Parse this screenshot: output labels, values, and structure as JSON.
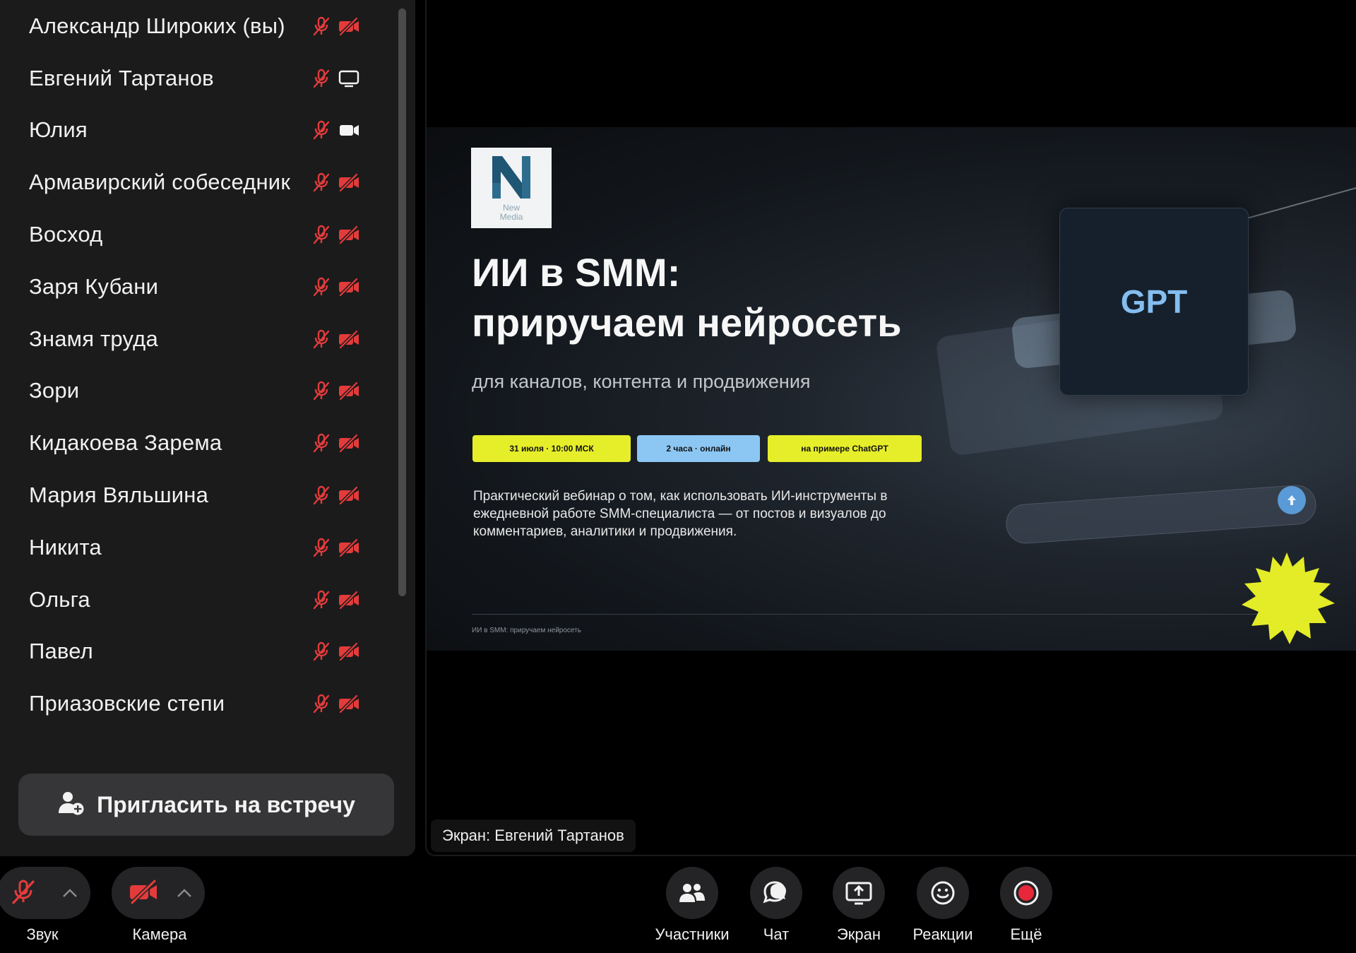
{
  "participants": [
    {
      "name": "Александр Широких (вы)",
      "mic": "muted",
      "video": "off"
    },
    {
      "name": "Евгений Тартанов",
      "mic": "muted",
      "video": "screen"
    },
    {
      "name": "Юлия",
      "mic": "muted",
      "video": "on"
    },
    {
      "name": "Армавирский собеседник",
      "mic": "muted",
      "video": "off"
    },
    {
      "name": "Восход",
      "mic": "muted",
      "video": "off"
    },
    {
      "name": "Заря Кубани",
      "mic": "muted",
      "video": "off"
    },
    {
      "name": "Знамя труда",
      "mic": "muted",
      "video": "off"
    },
    {
      "name": "Зори",
      "mic": "muted",
      "video": "off"
    },
    {
      "name": "Кидакоева Зарема",
      "mic": "muted",
      "video": "off"
    },
    {
      "name": "Мария Вяльшина",
      "mic": "muted",
      "video": "off"
    },
    {
      "name": "Никита",
      "mic": "muted",
      "video": "off"
    },
    {
      "name": "Ольга",
      "mic": "muted",
      "video": "off"
    },
    {
      "name": "Павел",
      "mic": "muted",
      "video": "off"
    },
    {
      "name": "Приазовские степи",
      "mic": "muted",
      "video": "off"
    }
  ],
  "invite_label": "Пригласить на встречу",
  "slide": {
    "logo_caption_1": "New",
    "logo_caption_2": "Media",
    "title_line1": "ИИ в SMM:",
    "title_line2": "приручаем нейросеть",
    "subtitle": "для каналов, контента и продвижения",
    "pills": [
      "31 июля · 10:00 МСК",
      "2 часа · онлайн",
      "на примере ChatGPT"
    ],
    "description": "Практический вебинар о том, как использовать ИИ-инструменты в ежедневной работе SMM-специалиста — от постов и визуалов до комментариев, аналитики и продвижения.",
    "footer": "ИИ в SMM: приручаем нейросеть",
    "gpt_card": "GPT"
  },
  "screen_label": "Экран: Евгений Тартанов",
  "toolbar": {
    "sound": "Звук",
    "camera": "Камера",
    "participants": "Участники",
    "chat": "Чат",
    "screen": "Экран",
    "reactions": "Реакции",
    "more": "Ещё"
  },
  "colors": {
    "muted_red": "#e33b3b",
    "pill_yellow": "#e6ee2a",
    "pill_blue": "#8cc7f3",
    "gpt_blue": "#84bdf0",
    "record_red": "#e8283a"
  }
}
